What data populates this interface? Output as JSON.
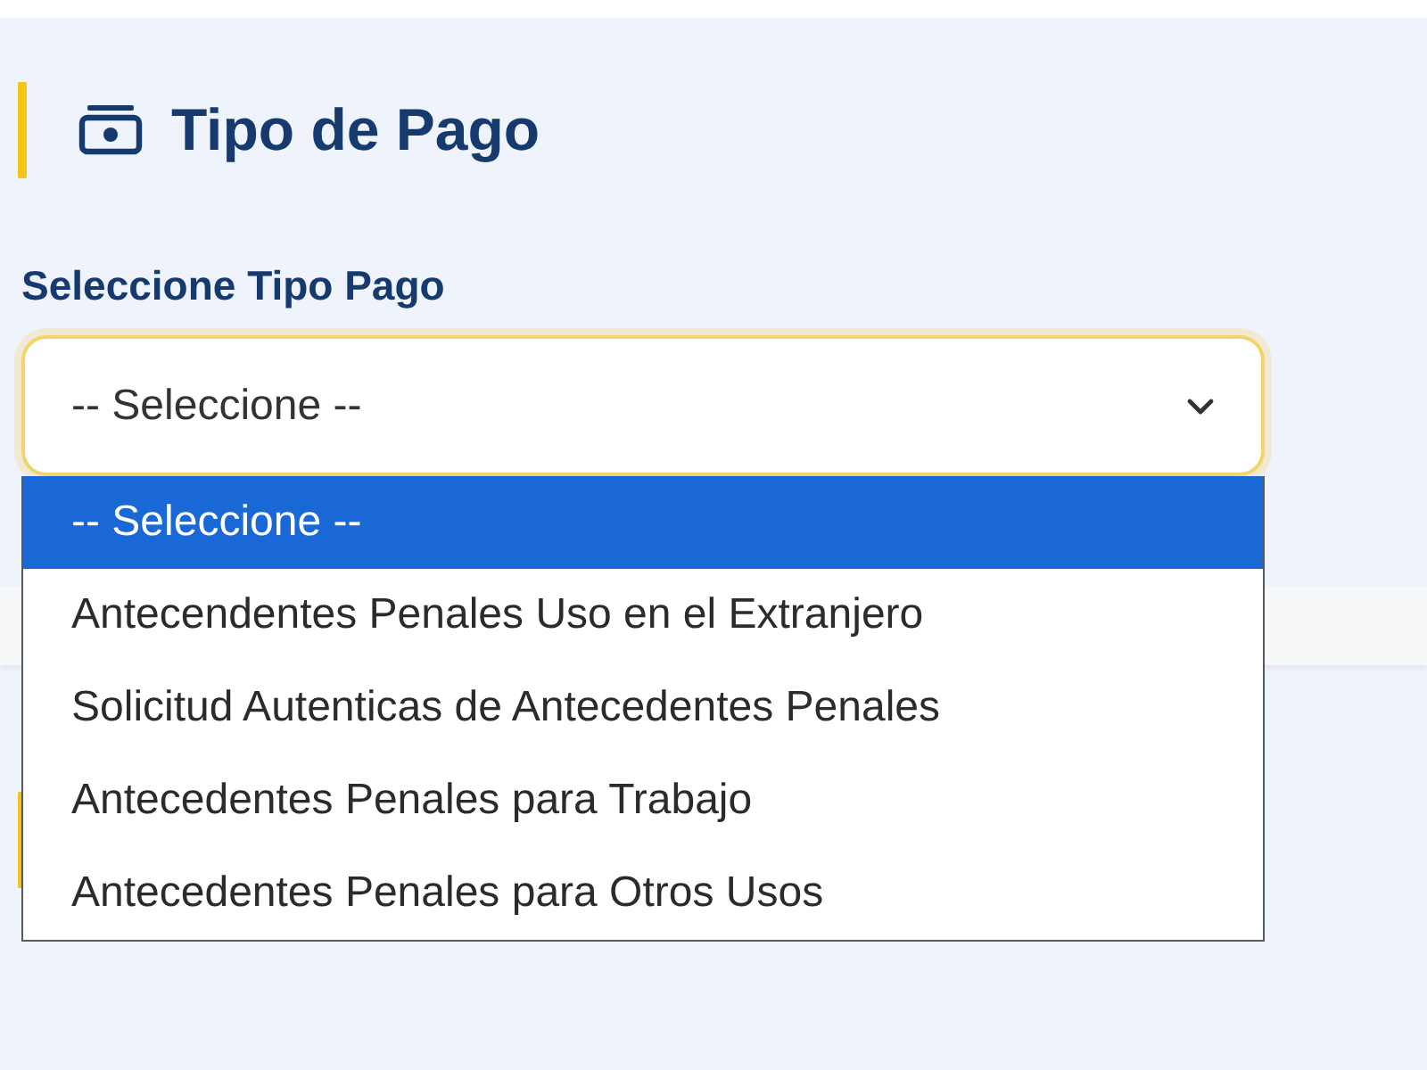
{
  "section": {
    "title": "Tipo de Pago"
  },
  "field": {
    "label": "Seleccione Tipo Pago",
    "value": "-- Seleccione --",
    "open": true
  },
  "options": [
    {
      "label": "-- Seleccione --",
      "selected": true
    },
    {
      "label": "Antecendentes Penales Uso en el Extranjero",
      "selected": false
    },
    {
      "label": "Solicitud Autenticas de Antecedentes Penales",
      "selected": false
    },
    {
      "label": "Antecedentes Penales para Trabajo",
      "selected": false
    },
    {
      "label": "Antecedentes Penales para Otros Usos",
      "selected": false
    }
  ]
}
